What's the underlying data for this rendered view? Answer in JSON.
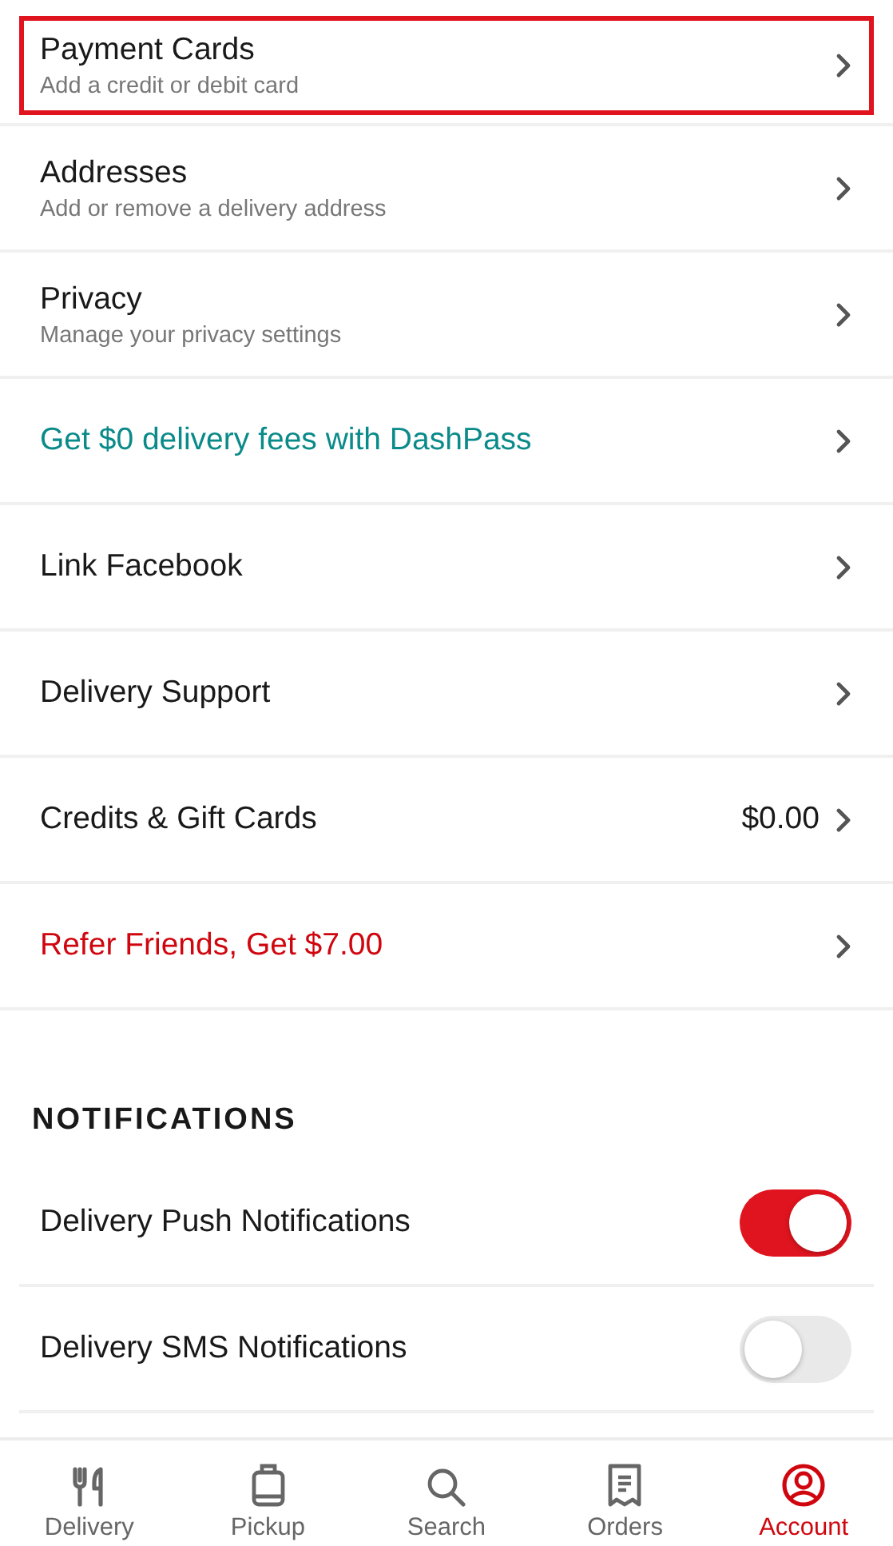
{
  "menu": [
    {
      "kind": "plain",
      "title": "Payment Cards",
      "subtitle": "Add a credit or debit card",
      "highlighted": true
    },
    {
      "kind": "plain",
      "title": "Addresses",
      "subtitle": "Add or remove a delivery address",
      "highlighted": false
    },
    {
      "kind": "plain",
      "title": "Privacy",
      "subtitle": "Manage your privacy settings",
      "highlighted": false
    },
    {
      "kind": "promo",
      "title": "Get $0 delivery fees with DashPass",
      "highlighted": false
    },
    {
      "kind": "plain",
      "title": "Link Facebook",
      "highlighted": false
    },
    {
      "kind": "plain",
      "title": "Delivery Support",
      "highlighted": false
    },
    {
      "kind": "plain",
      "title": "Credits & Gift Cards",
      "value": "$0.00",
      "highlighted": false
    },
    {
      "kind": "referral",
      "title": "Refer Friends, Get $7.00",
      "highlighted": false
    }
  ],
  "notifications": {
    "heading": "NOTIFICATIONS",
    "items": [
      {
        "label": "Delivery Push Notifications",
        "on": true
      },
      {
        "label": "Delivery SMS Notifications",
        "on": false
      }
    ]
  },
  "tabs": [
    {
      "kind": "delivery",
      "label": "Delivery",
      "selected": false
    },
    {
      "kind": "pickup",
      "label": "Pickup",
      "selected": false
    },
    {
      "kind": "search",
      "label": "Search",
      "selected": false
    },
    {
      "kind": "orders",
      "label": "Orders",
      "selected": false
    },
    {
      "kind": "account",
      "label": "Account",
      "selected": true
    }
  ]
}
